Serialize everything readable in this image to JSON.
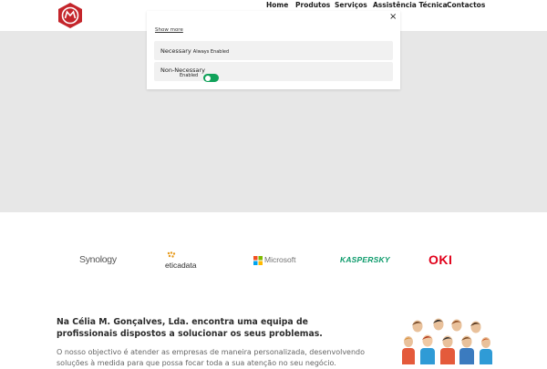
{
  "nav": {
    "items": [
      {
        "label": "Home"
      },
      {
        "label": "Produtos"
      },
      {
        "label": "Serviços"
      },
      {
        "label": "Assistência Técnica"
      },
      {
        "label": "Contactos"
      }
    ]
  },
  "consent": {
    "close_glyph": "×",
    "show_more": "Show more",
    "categories": [
      {
        "title": "Necessary",
        "status": "Always Enabled"
      },
      {
        "title": "Non-Necessary",
        "status": "Enabled"
      }
    ]
  },
  "partners": [
    {
      "name": "Synology",
      "icon": "synology-logo"
    },
    {
      "name": "eticadata",
      "icon": "eticadata-logo"
    },
    {
      "name": "Microsoft",
      "icon": "microsoft-logo"
    },
    {
      "name": "KASPERSKY",
      "icon": "kaspersky-logo"
    },
    {
      "name": "OKI",
      "icon": "oki-logo"
    }
  ],
  "about": {
    "heading": "Na Célia M. Gonçalves, Lda. encontra uma equipa de profissionais dispostos a solucionar os seus problemas.",
    "paragraph": "O nosso objectivo é atender as empresas de maneira personalizada, desenvolvendo soluções à medida para que possa focar toda a sua atenção no seu negócio."
  },
  "colors": {
    "brand_red": "#c4252b",
    "toggle_green": "#10a25a",
    "kaspersky_green": "#0b9a6a",
    "oki_red": "#e1001a",
    "hero_bg": "#e7e7e7"
  }
}
